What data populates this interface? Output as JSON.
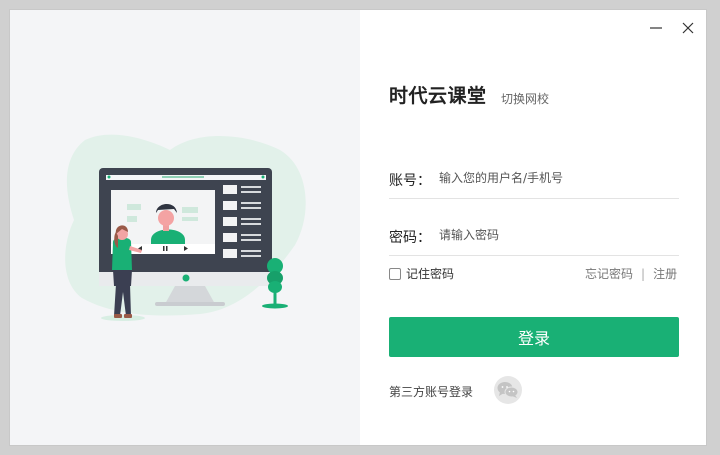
{
  "window": {
    "controls": {
      "minimize_icon": "minimize-icon",
      "close_icon": "close-icon"
    }
  },
  "app": {
    "title": "时代云课堂",
    "switch_school": "切换网校"
  },
  "form": {
    "account_label": "账号：",
    "account_placeholder": "输入您的用户名/手机号",
    "password_label": "密码：",
    "password_placeholder": "请输入密码",
    "remember_label": "记住密码",
    "forgot_label": "忘记密码",
    "separator": "|",
    "register_label": "注册",
    "login_button": "登录"
  },
  "third_party": {
    "label": "第三方账号登录",
    "icon": "wechat-icon"
  },
  "colors": {
    "accent": "#19b075",
    "left_panel_bg": "#f4f5f7",
    "blob": "#e2f1ea"
  }
}
